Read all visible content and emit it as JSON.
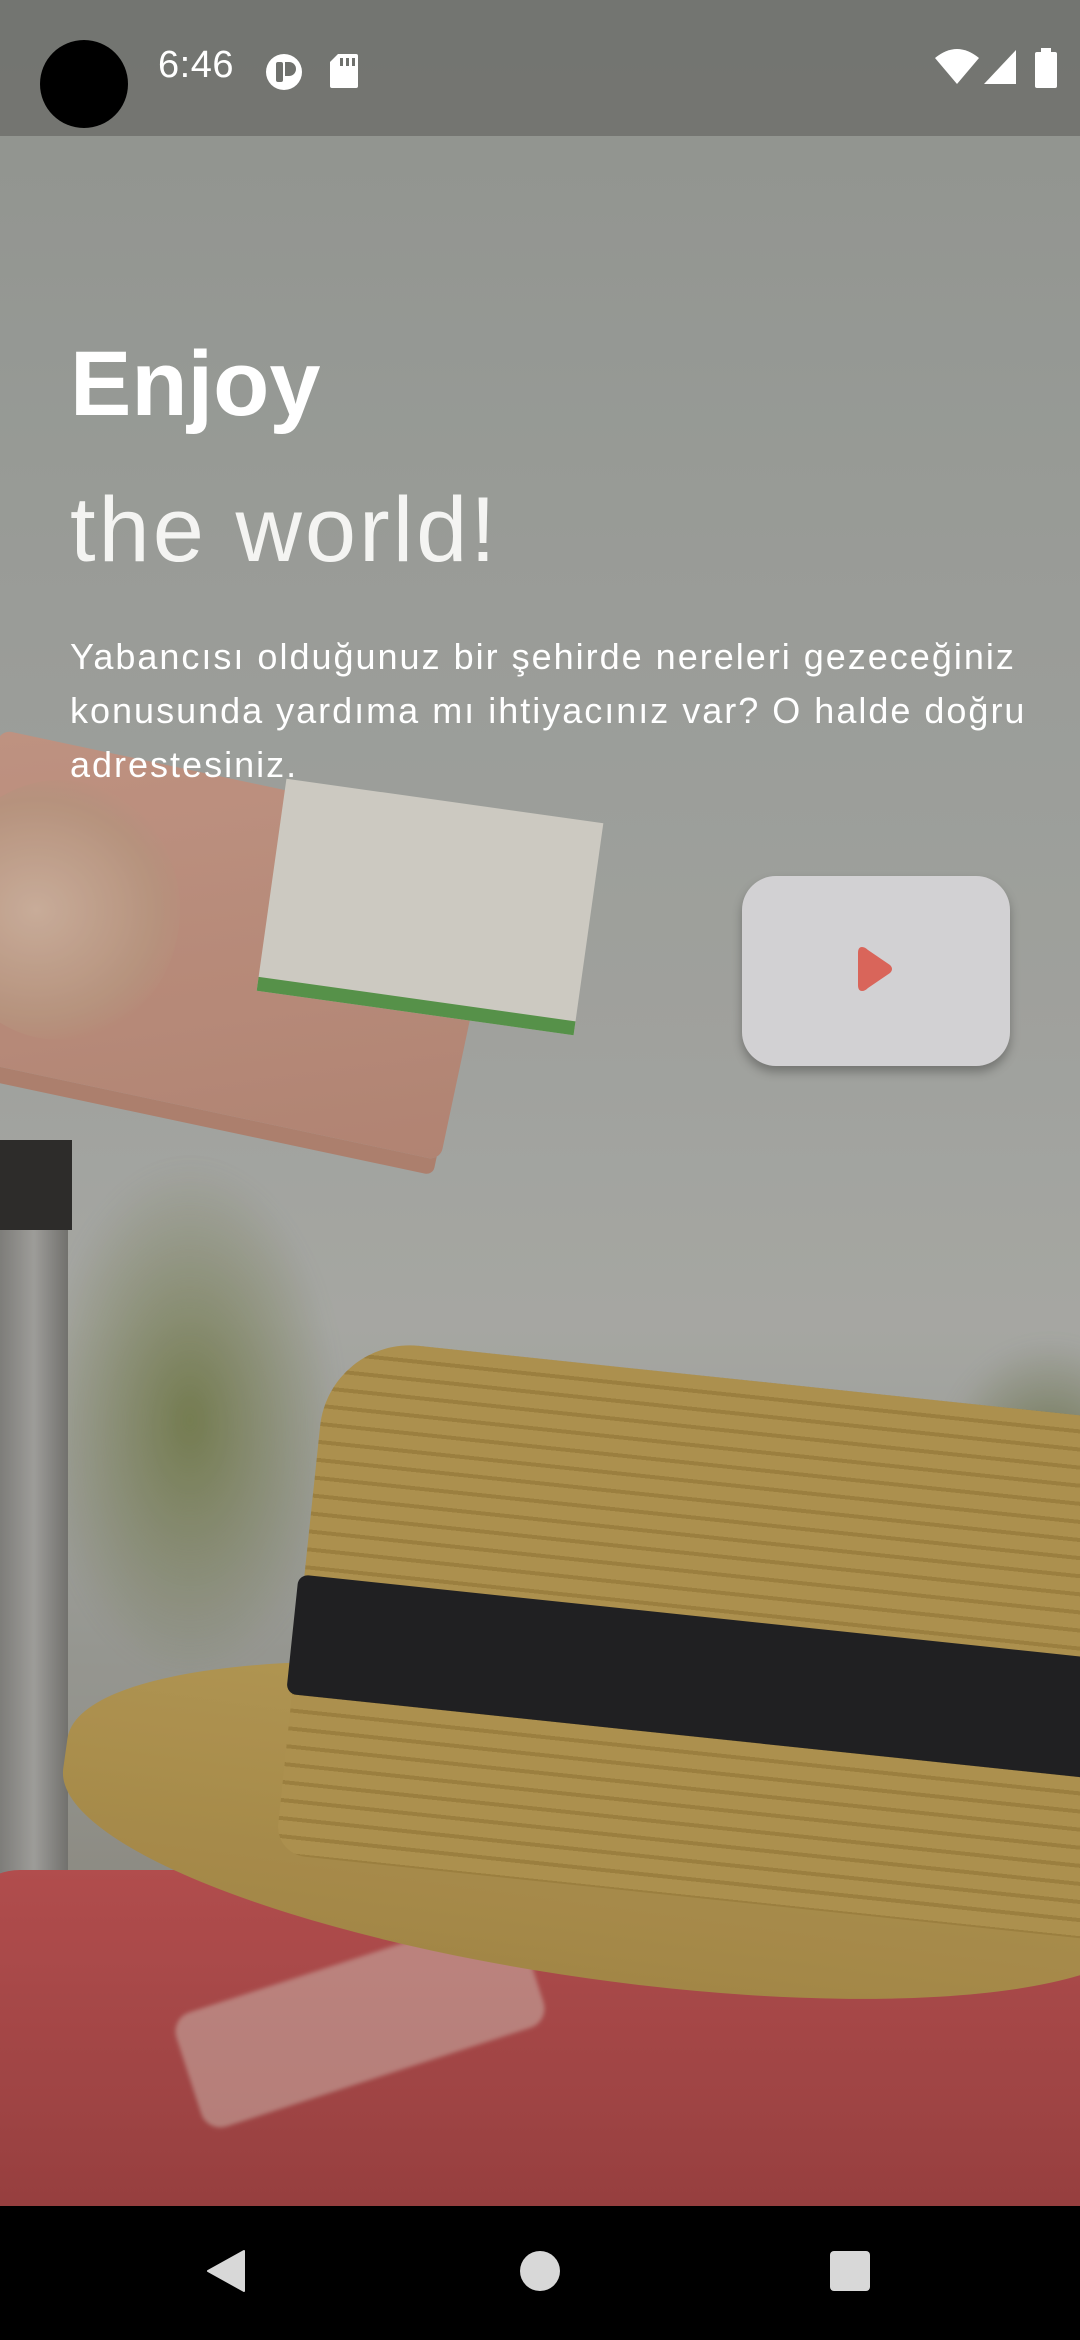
{
  "status_bar": {
    "time": "6:46",
    "left_icons": [
      "alarm-badge-icon",
      "sd-card-icon"
    ],
    "right_icons": [
      "wifi-icon",
      "cellular-signal-icon",
      "battery-icon"
    ]
  },
  "hero": {
    "title_line1": "Enjoy",
    "title_line2": "the world!",
    "description": "Yabancısı olduğunuz bir şehirde nereleri gezeceğiniz konusunda yardıma mı ihtiyacınız var? O halde doğru adrestesiniz."
  },
  "next_button": {
    "icon": "play-arrow-icon",
    "icon_color": "#d9655a",
    "background": "#d2d1d3"
  },
  "navigation_bar": {
    "buttons": [
      "back-icon",
      "home-icon",
      "recents-icon"
    ]
  }
}
